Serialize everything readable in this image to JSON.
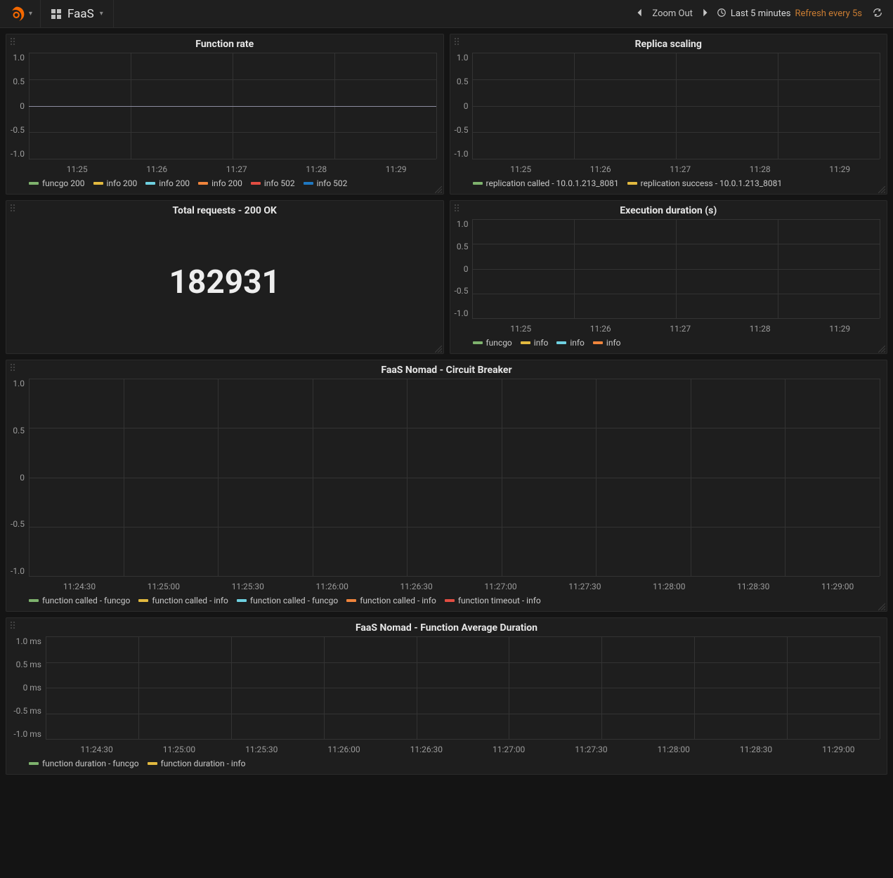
{
  "nav": {
    "dashboard_name": "FaaS",
    "zoom_out": "Zoom Out",
    "time_range": "Last 5 minutes",
    "refresh_label": "Refresh every 5s"
  },
  "panels": {
    "function_rate": {
      "title": "Function rate",
      "y_ticks": [
        "1.0",
        "0.5",
        "0",
        "-0.5",
        "-1.0"
      ],
      "x_ticks": [
        "11:25",
        "11:26",
        "11:27",
        "11:28",
        "11:29"
      ],
      "legend": [
        {
          "label": "funcgo 200",
          "color": "#7eb26d"
        },
        {
          "label": "info 200",
          "color": "#e2b93f"
        },
        {
          "label": "info 200",
          "color": "#6ed0e0"
        },
        {
          "label": "info 200",
          "color": "#ef843c"
        },
        {
          "label": "info 502",
          "color": "#e24d42"
        },
        {
          "label": "info 502",
          "color": "#1f78c1"
        }
      ]
    },
    "replica_scaling": {
      "title": "Replica scaling",
      "y_ticks": [
        "1.0",
        "0.5",
        "0",
        "-0.5",
        "-1.0"
      ],
      "x_ticks": [
        "11:25",
        "11:26",
        "11:27",
        "11:28",
        "11:29"
      ],
      "legend": [
        {
          "label": "replication called - 10.0.1.213_8081",
          "color": "#7eb26d"
        },
        {
          "label": "replication success - 10.0.1.213_8081",
          "color": "#e2b93f"
        }
      ]
    },
    "total_requests": {
      "title": "Total requests - 200 OK",
      "value": "182931"
    },
    "exec_duration": {
      "title": "Execution duration (s)",
      "y_ticks": [
        "1.0",
        "0.5",
        "0",
        "-0.5",
        "-1.0"
      ],
      "x_ticks": [
        "11:25",
        "11:26",
        "11:27",
        "11:28",
        "11:29"
      ],
      "legend": [
        {
          "label": "funcgo",
          "color": "#7eb26d"
        },
        {
          "label": "info",
          "color": "#e2b93f"
        },
        {
          "label": "info",
          "color": "#6ed0e0"
        },
        {
          "label": "info",
          "color": "#ef843c"
        }
      ]
    },
    "circuit_breaker": {
      "title": "FaaS Nomad - Circuit Breaker",
      "y_ticks": [
        "1.0",
        "0.5",
        "0",
        "-0.5",
        "-1.0"
      ],
      "x_ticks": [
        "11:24:30",
        "11:25:00",
        "11:25:30",
        "11:26:00",
        "11:26:30",
        "11:27:00",
        "11:27:30",
        "11:28:00",
        "11:28:30",
        "11:29:00"
      ],
      "legend": [
        {
          "label": "function called - funcgo",
          "color": "#7eb26d"
        },
        {
          "label": "function called - info",
          "color": "#e2b93f"
        },
        {
          "label": "function called - funcgo",
          "color": "#6ed0e0"
        },
        {
          "label": "function called - info",
          "color": "#ef843c"
        },
        {
          "label": "function timeout - info",
          "color": "#e24d42"
        }
      ]
    },
    "avg_duration": {
      "title": "FaaS Nomad - Function Average Duration",
      "y_ticks": [
        "1.0 ms",
        "0.5 ms",
        "0 ms",
        "-0.5 ms",
        "-1.0 ms"
      ],
      "x_ticks": [
        "11:24:30",
        "11:25:00",
        "11:25:30",
        "11:26:00",
        "11:26:30",
        "11:27:00",
        "11:27:30",
        "11:28:00",
        "11:28:30",
        "11:29:00"
      ],
      "legend": [
        {
          "label": "function duration - funcgo",
          "color": "#7eb26d"
        },
        {
          "label": "function duration - info",
          "color": "#e2b93f"
        }
      ]
    }
  },
  "chart_data": [
    {
      "panel": "function_rate",
      "type": "line",
      "title": "Function rate",
      "x": [
        "11:25",
        "11:26",
        "11:27",
        "11:28",
        "11:29"
      ],
      "ylim": [
        -1.0,
        1.0
      ],
      "series": [
        {
          "name": "funcgo 200",
          "values": [
            0,
            0,
            0,
            0,
            0
          ]
        },
        {
          "name": "info 200",
          "values": [
            0,
            0,
            0,
            0,
            0
          ]
        },
        {
          "name": "info 200",
          "values": [
            0,
            0,
            0,
            0,
            0
          ]
        },
        {
          "name": "info 200",
          "values": [
            0,
            0,
            0,
            0,
            0
          ]
        },
        {
          "name": "info 502",
          "values": [
            0,
            0,
            0,
            0,
            0
          ]
        },
        {
          "name": "info 502",
          "values": [
            0,
            0,
            0,
            0,
            0
          ]
        }
      ]
    },
    {
      "panel": "replica_scaling",
      "type": "line",
      "title": "Replica scaling",
      "x": [
        "11:25",
        "11:26",
        "11:27",
        "11:28",
        "11:29"
      ],
      "ylim": [
        -1.0,
        1.0
      ],
      "series": [
        {
          "name": "replication called - 10.0.1.213_8081",
          "values": [
            null,
            null,
            null,
            null,
            null
          ]
        },
        {
          "name": "replication success - 10.0.1.213_8081",
          "values": [
            null,
            null,
            null,
            null,
            null
          ]
        }
      ]
    },
    {
      "panel": "total_requests",
      "type": "singlestat",
      "title": "Total requests - 200 OK",
      "value": 182931
    },
    {
      "panel": "exec_duration",
      "type": "line",
      "title": "Execution duration (s)",
      "x": [
        "11:25",
        "11:26",
        "11:27",
        "11:28",
        "11:29"
      ],
      "ylim": [
        -1.0,
        1.0
      ],
      "series": [
        {
          "name": "funcgo",
          "values": [
            null,
            null,
            null,
            null,
            null
          ]
        },
        {
          "name": "info",
          "values": [
            null,
            null,
            null,
            null,
            null
          ]
        },
        {
          "name": "info",
          "values": [
            null,
            null,
            null,
            null,
            null
          ]
        },
        {
          "name": "info",
          "values": [
            null,
            null,
            null,
            null,
            null
          ]
        }
      ]
    },
    {
      "panel": "circuit_breaker",
      "type": "line",
      "title": "FaaS Nomad - Circuit Breaker",
      "x": [
        "11:24:30",
        "11:25:00",
        "11:25:30",
        "11:26:00",
        "11:26:30",
        "11:27:00",
        "11:27:30",
        "11:28:00",
        "11:28:30",
        "11:29:00"
      ],
      "ylim": [
        -1.0,
        1.0
      ],
      "series": [
        {
          "name": "function called - funcgo",
          "values": [
            null,
            null,
            null,
            null,
            null,
            null,
            null,
            null,
            null,
            null
          ]
        },
        {
          "name": "function called - info",
          "values": [
            null,
            null,
            null,
            null,
            null,
            null,
            null,
            null,
            null,
            null
          ]
        },
        {
          "name": "function called - funcgo",
          "values": [
            null,
            null,
            null,
            null,
            null,
            null,
            null,
            null,
            null,
            null
          ]
        },
        {
          "name": "function called - info",
          "values": [
            null,
            null,
            null,
            null,
            null,
            null,
            null,
            null,
            null,
            null
          ]
        },
        {
          "name": "function timeout - info",
          "values": [
            null,
            null,
            null,
            null,
            null,
            null,
            null,
            null,
            null,
            null
          ]
        }
      ]
    },
    {
      "panel": "avg_duration",
      "type": "line",
      "title": "FaaS Nomad - Function Average Duration",
      "x": [
        "11:24:30",
        "11:25:00",
        "11:25:30",
        "11:26:00",
        "11:26:30",
        "11:27:00",
        "11:27:30",
        "11:28:00",
        "11:28:30",
        "11:29:00"
      ],
      "ylim": [
        -1.0,
        1.0
      ],
      "yunit": "ms",
      "series": [
        {
          "name": "function duration - funcgo",
          "values": [
            null,
            null,
            null,
            null,
            null,
            null,
            null,
            null,
            null,
            null
          ]
        },
        {
          "name": "function duration - info",
          "values": [
            null,
            null,
            null,
            null,
            null,
            null,
            null,
            null,
            null,
            null
          ]
        }
      ]
    }
  ]
}
